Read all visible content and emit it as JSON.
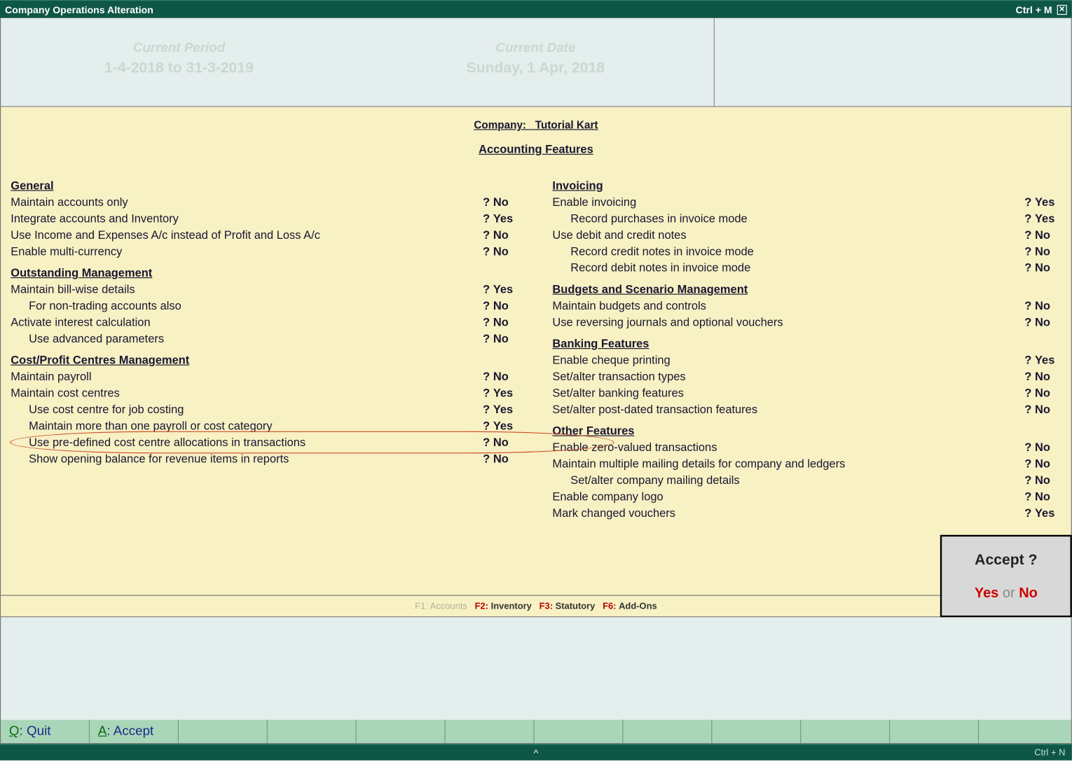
{
  "titlebar": {
    "title": "Company Operations  Alteration",
    "shortcut": "Ctrl + M"
  },
  "period": {
    "label": "Current Period",
    "value": "1-4-2018 to 31-3-2019"
  },
  "date": {
    "label": "Current Date",
    "value": "Sunday, 1 Apr, 2018"
  },
  "company_label": "Company:",
  "company_name": "Tutorial Kart",
  "page_title": "Accounting Features",
  "sections": {
    "general": {
      "head": "General",
      "r0": {
        "label": "Maintain accounts only",
        "val": "No"
      },
      "r1": {
        "label": "Integrate accounts and Inventory",
        "val": "Yes"
      },
      "r2": {
        "label": "Use Income and Expenses A/c instead of Profit and Loss A/c",
        "val": "No"
      },
      "r3": {
        "label": "Enable multi-currency",
        "val": "No"
      }
    },
    "outstanding": {
      "head": "Outstanding Management",
      "r0": {
        "label": "Maintain bill-wise details",
        "val": "Yes"
      },
      "r1": {
        "label": "For non-trading accounts also",
        "val": "No"
      },
      "r2": {
        "label": "Activate interest calculation",
        "val": "No"
      },
      "r3": {
        "label": "Use advanced parameters",
        "val": "No"
      }
    },
    "cost": {
      "head": "Cost/Profit Centres Management",
      "r0": {
        "label": "Maintain payroll",
        "val": "No"
      },
      "r1": {
        "label": "Maintain cost centres",
        "val": "Yes"
      },
      "r2": {
        "label": "Use cost centre for job costing",
        "val": "Yes"
      },
      "r3": {
        "label": "Maintain more than one payroll or cost category",
        "val": "Yes"
      },
      "r4": {
        "label": "Use pre-defined cost centre allocations in transactions",
        "val": "No"
      },
      "r5": {
        "label": "Show opening balance for revenue items in reports",
        "val": "No"
      }
    },
    "invoicing": {
      "head": "Invoicing",
      "r0": {
        "label": "Enable invoicing",
        "val": "Yes"
      },
      "r1": {
        "label": "Record purchases in invoice mode",
        "val": "Yes"
      },
      "r2": {
        "label": "Use debit and credit notes",
        "val": "No"
      },
      "r3": {
        "label": "Record credit notes in invoice mode",
        "val": "No"
      },
      "r4": {
        "label": "Record debit notes in invoice mode",
        "val": "No"
      }
    },
    "budgets": {
      "head": "Budgets and Scenario Management",
      "r0": {
        "label": "Maintain budgets and controls",
        "val": "No"
      },
      "r1": {
        "label": "Use reversing journals and optional vouchers",
        "val": "No"
      }
    },
    "banking": {
      "head": "Banking Features",
      "r0": {
        "label": "Enable cheque printing",
        "val": "Yes"
      },
      "r1": {
        "label": "Set/alter transaction types",
        "val": "No"
      },
      "r2": {
        "label": "Set/alter banking features",
        "val": "No"
      },
      "r3": {
        "label": "Set/alter post-dated transaction features",
        "val": "No"
      }
    },
    "other": {
      "head": "Other Features",
      "r0": {
        "label": "Enable zero-valued transactions",
        "val": "No"
      },
      "r1": {
        "label": "Maintain multiple mailing details for company and ledgers",
        "val": "No"
      },
      "r2": {
        "label": "Set/alter company mailing details",
        "val": "No"
      },
      "r3": {
        "label": "Enable company logo",
        "val": "No"
      },
      "r4": {
        "label": "Mark changed vouchers",
        "val": "Yes"
      }
    }
  },
  "fkeys": {
    "f1": "F1: Accounts",
    "f2k": "F2:",
    "f2v": "Inventory",
    "f3k": "F3:",
    "f3v": "Statutory",
    "f6k": "F6:",
    "f6v": "Add-Ons"
  },
  "accept": {
    "question": "Accept ?",
    "yes": "Yes",
    "or": "or",
    "no": "No"
  },
  "bottom": {
    "quit_hot": "Q",
    "quit": ": Quit",
    "accept_hot": "A",
    "accept": ": Accept"
  },
  "statusbar": {
    "shortcut": "Ctrl + N"
  }
}
